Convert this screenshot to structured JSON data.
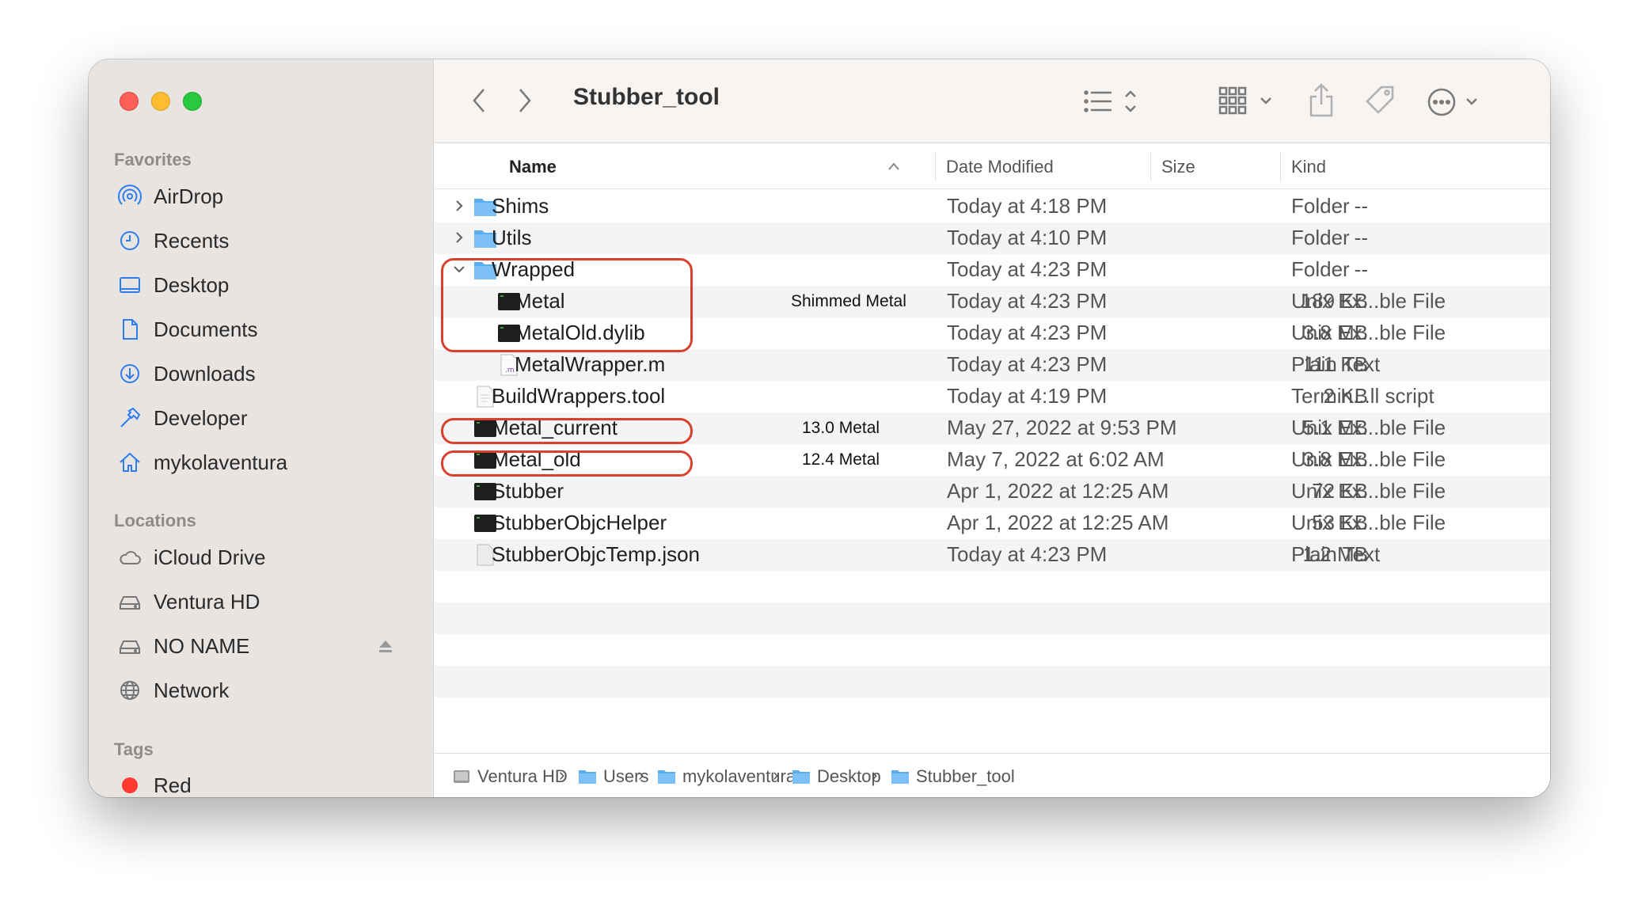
{
  "window": {
    "title": "Stubber_tool"
  },
  "sidebar": {
    "favorites_title": "Favorites",
    "favorites": [
      {
        "label": "AirDrop",
        "icon": "airdrop-icon"
      },
      {
        "label": "Recents",
        "icon": "clock-icon"
      },
      {
        "label": "Desktop",
        "icon": "desktop-icon"
      },
      {
        "label": "Documents",
        "icon": "document-icon"
      },
      {
        "label": "Downloads",
        "icon": "download-icon"
      },
      {
        "label": "Developer",
        "icon": "hammer-icon"
      },
      {
        "label": "mykolaventura",
        "icon": "home-icon"
      }
    ],
    "locations_title": "Locations",
    "locations": [
      {
        "label": "iCloud Drive",
        "icon": "cloud-icon"
      },
      {
        "label": "Ventura HD",
        "icon": "drive-icon"
      },
      {
        "label": "NO NAME",
        "icon": "drive-icon"
      },
      {
        "label": "Network",
        "icon": "globe-icon"
      }
    ],
    "tags_title": "Tags",
    "tags": [
      {
        "label": "Red",
        "color": "#ff3b30"
      }
    ]
  },
  "columns": {
    "name": "Name",
    "date": "Date Modified",
    "size": "Size",
    "kind": "Kind"
  },
  "files": [
    {
      "name": "Shims",
      "date": "Today at 4:18 PM",
      "size": "--",
      "kind": "Folder",
      "type": "folder"
    },
    {
      "name": "Utils",
      "date": "Today at 4:10 PM",
      "size": "--",
      "kind": "Folder",
      "type": "folder"
    },
    {
      "name": "Wrapped",
      "date": "Today at 4:23 PM",
      "size": "--",
      "kind": "Folder",
      "type": "folder"
    },
    {
      "name": "Metal",
      "date": "Today at 4:23 PM",
      "size": "189 KB",
      "kind": "Unix Ex...ble File",
      "type": "exec"
    },
    {
      "name": "MetalOld.dylib",
      "date": "Today at 4:23 PM",
      "size": "3.8 MB",
      "kind": "Unix Ex...ble File",
      "type": "exec"
    },
    {
      "name": "MetalWrapper.m",
      "date": "Today at 4:23 PM",
      "size": "111 KB",
      "kind": "Plain Text",
      "type": "source"
    },
    {
      "name": "BuildWrappers.tool",
      "date": "Today at 4:19 PM",
      "size": "2 KB",
      "kind": "Termin...ll script",
      "type": "script"
    },
    {
      "name": "Metal_current",
      "date": "May 27, 2022 at 9:53 PM",
      "size": "5.1 MB",
      "kind": "Unix Ex...ble File",
      "type": "exec"
    },
    {
      "name": "Metal_old",
      "date": "May 7, 2022 at 6:02 AM",
      "size": "3.8 MB",
      "kind": "Unix Ex...ble File",
      "type": "exec"
    },
    {
      "name": "Stubber",
      "date": "Apr 1, 2022 at 12:25 AM",
      "size": "72 KB",
      "kind": "Unix Ex...ble File",
      "type": "exec"
    },
    {
      "name": "StubberObjcHelper",
      "date": "Apr 1, 2022 at 12:25 AM",
      "size": "53 KB",
      "kind": "Unix Ex...ble File",
      "type": "exec"
    },
    {
      "name": "StubberObjcTemp.json",
      "date": "Today at 4:23 PM",
      "size": "1.2 MB",
      "kind": "Plain Text",
      "type": "text"
    }
  ],
  "annotations": {
    "metal": "Shimmed Metal",
    "metal_current": "13.0 Metal",
    "metal_old": "12.4 Metal"
  },
  "pathbar": [
    "Ventura HD",
    "Users",
    "mykolaventura",
    "Desktop",
    "Stubber_tool"
  ],
  "colors": {
    "highlight": "#d9412f",
    "folder": "#5aaef0"
  }
}
